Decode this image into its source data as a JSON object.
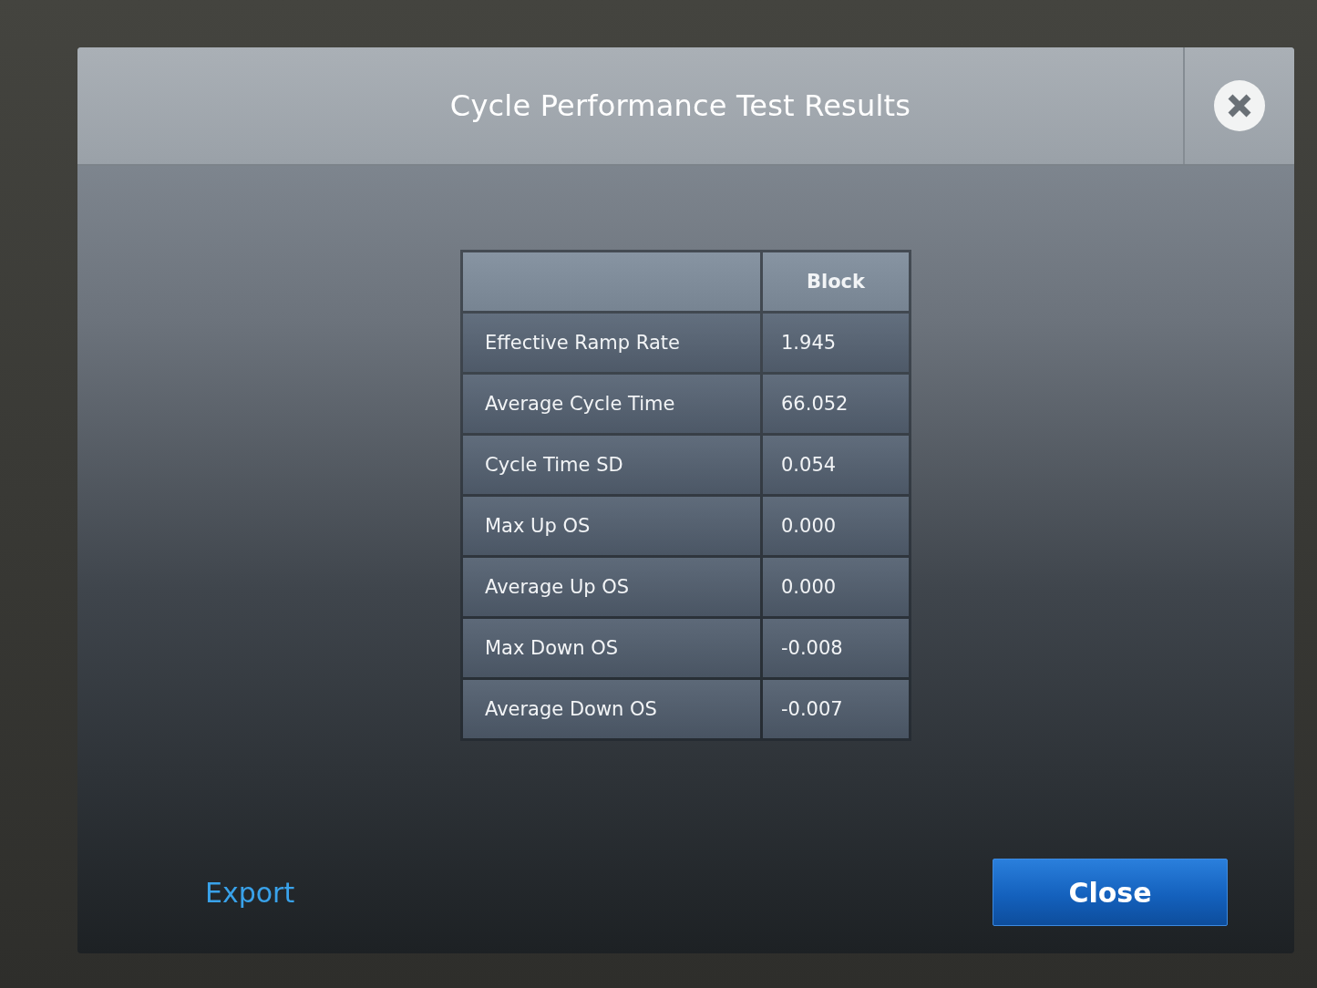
{
  "dialog": {
    "title": "Cycle Performance Test Results"
  },
  "table": {
    "value_column": "Block",
    "rows": [
      {
        "metric": "Effective Ramp Rate",
        "value": "1.945"
      },
      {
        "metric": "Average Cycle Time",
        "value": "66.052"
      },
      {
        "metric": "Cycle Time SD",
        "value": "0.054"
      },
      {
        "metric": "Max Up OS",
        "value": "0.000"
      },
      {
        "metric": "Average Up OS",
        "value": "0.000"
      },
      {
        "metric": "Max Down OS",
        "value": "-0.008"
      },
      {
        "metric": "Average Down OS",
        "value": "-0.007"
      }
    ]
  },
  "actions": {
    "export": "Export",
    "close": "Close"
  }
}
